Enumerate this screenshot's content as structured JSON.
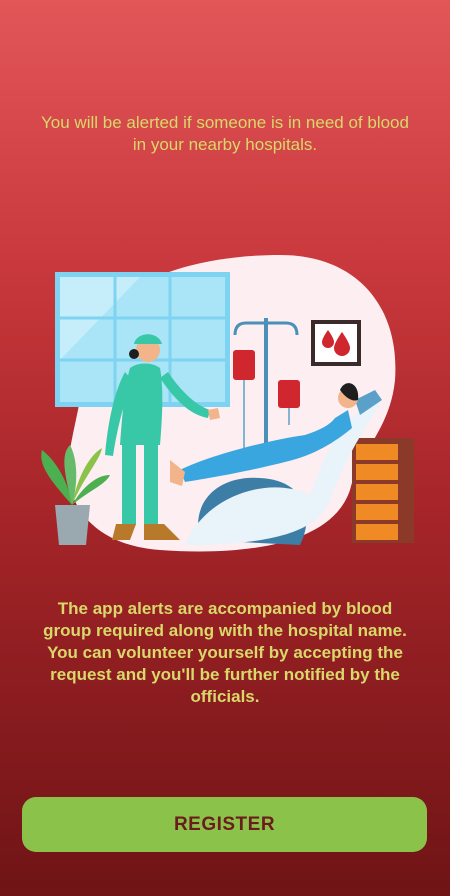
{
  "intro": {
    "alert_text": "You will be alerted if someone is in need of blood in your nearby hospitals."
  },
  "details": {
    "description": "The app alerts are accompanied by blood group required along with the hospital name. You can volunteer yourself by accepting the request and you'll be further notified by the officials."
  },
  "actions": {
    "register_label": "REGISTER"
  },
  "colors": {
    "text_accent": "#d9d86a",
    "button_bg": "#8bc34a",
    "button_text": "#6b1c1c"
  },
  "illustration": {
    "icon": "hospital-blood-donation-illustration"
  }
}
